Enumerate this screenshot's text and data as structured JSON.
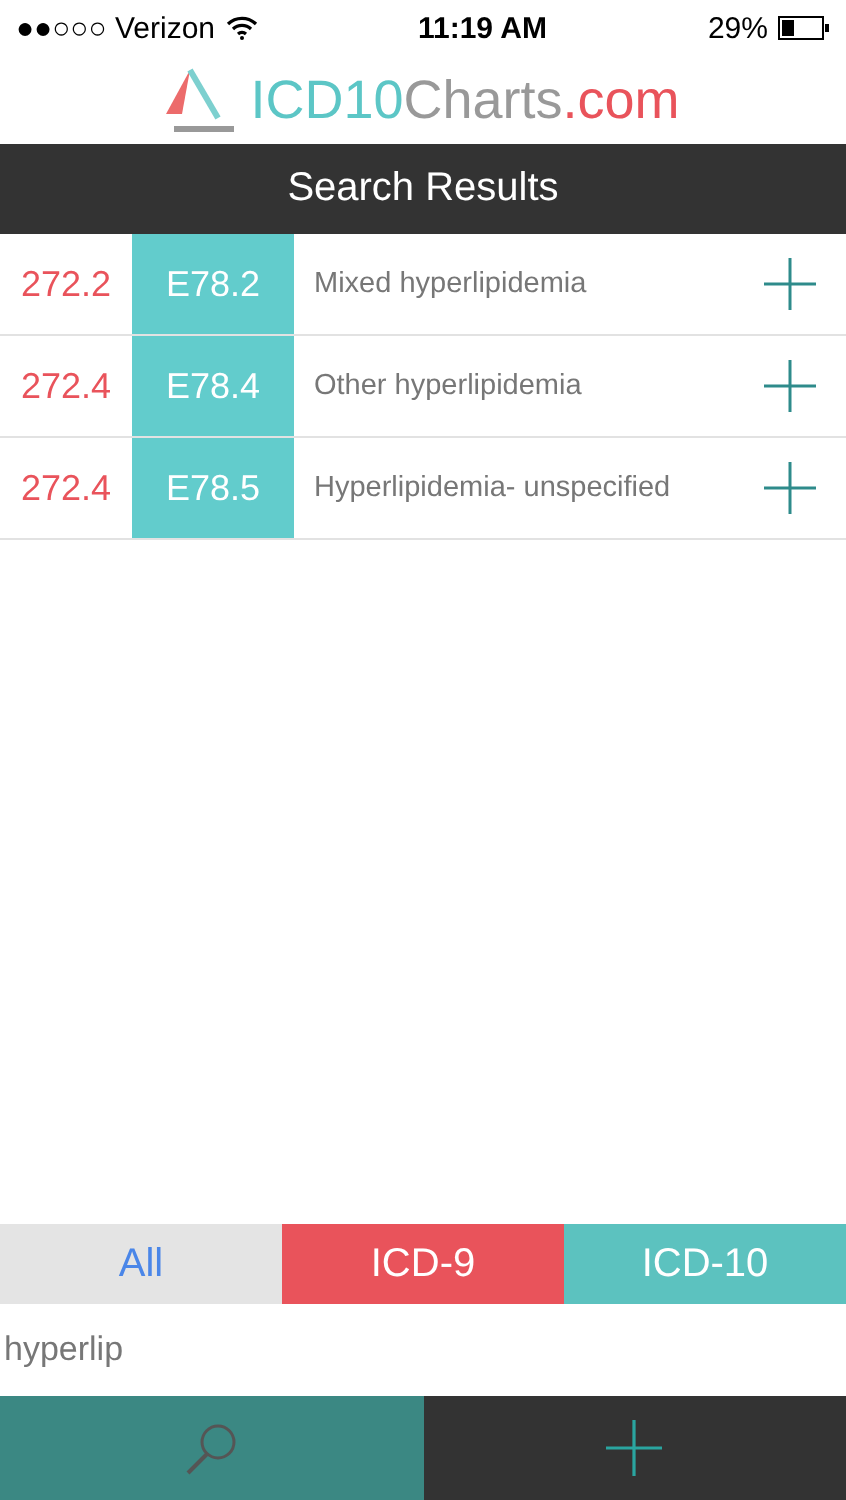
{
  "status_bar": {
    "carrier": "●●○○○ Verizon",
    "time": "11:19 AM",
    "battery": "29%"
  },
  "logo": {
    "parts": [
      {
        "text": "ICD10",
        "color": "#5cc6c6"
      },
      {
        "text": "Charts",
        "color": "#999999"
      },
      {
        "text": ".com",
        "color": "#e9535b"
      }
    ]
  },
  "header": {
    "title": "Search Results"
  },
  "results": [
    {
      "icd9": "272.2",
      "icd10": "E78.2",
      "description": "Mixed hyperlipidemia"
    },
    {
      "icd9": "272.4",
      "icd10": "E78.4",
      "description": "Other hyperlipidemia"
    },
    {
      "icd9": "272.4",
      "icd10": "E78.5",
      "description": "Hyperlipidemia- unspecified"
    }
  ],
  "filters": [
    {
      "label": "All",
      "color": "#e4e4e4"
    },
    {
      "label": "ICD-9",
      "color": "#e9535b"
    },
    {
      "label": "ICD-10",
      "color": "#5cc2bf"
    }
  ],
  "search": {
    "value": "hyperlip"
  },
  "bottom_tabs": [
    {
      "kind": "search",
      "selected": true
    },
    {
      "kind": "add",
      "selected": false
    }
  ]
}
